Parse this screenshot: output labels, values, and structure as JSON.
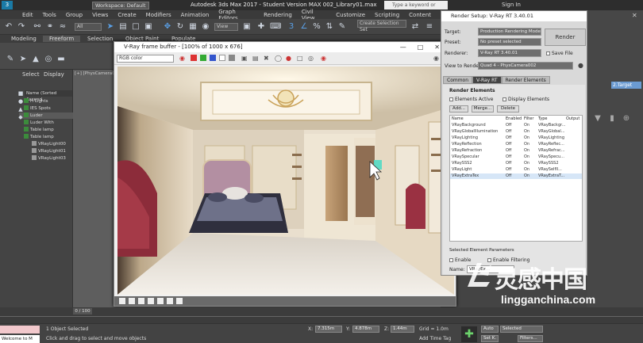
{
  "titlebar": {
    "workspace": "Workspace: Default",
    "title": "Autodesk 3ds Max 2017 - Student Version   MAX 002_Library01.max",
    "search_placeholder": "Type a keyword or phrase",
    "sign_in": "Sign In"
  },
  "menu": [
    "Edit",
    "Tools",
    "Group",
    "Views",
    "Create",
    "Modifiers",
    "Animation",
    "Graph Editors",
    "Rendering",
    "Civil View",
    "Customize",
    "Scripting",
    "Content"
  ],
  "toolbar": {
    "filter": "All",
    "view": "View",
    "selection_set": "Create Selection Set"
  },
  "ribbon_tabs": [
    "Modeling",
    "Freeform",
    "Selection",
    "Object Paint",
    "Populate"
  ],
  "scene": {
    "select_label": "Select",
    "display_label": "Display",
    "name_header": "Name (Sorted Ascend",
    "items": [
      "H Lights",
      "IES Spots",
      "Luder",
      "Luder With",
      "Table lamp",
      "Table lamp",
      "VRayLight00",
      "VRayLight01",
      "VRayLight03"
    ]
  },
  "viewport": {
    "label": "[+] [PhysCamera002",
    "frame": "0 / 100"
  },
  "vfb": {
    "title": "V-Ray frame buffer - [100% of 1000 x 676]",
    "channel": "RGB color"
  },
  "render_setup": {
    "title": "Render Setup: V-Ray RT 3.40.01",
    "target_label": "Target:",
    "target_value": "Production Rendering Mode",
    "preset_label": "Preset:",
    "preset_value": "No preset selected",
    "renderer_label": "Renderer:",
    "renderer_value": "V-Ray RT 3.40.01",
    "save_file": "Save File",
    "view_label": "View to Render:",
    "view_value": "Quad 4 - PhysCamera002",
    "render_button": "Render",
    "tabs": [
      "Common",
      "V-Ray RT",
      "Render Elements"
    ],
    "elements_header": "Render Elements",
    "elements_active": "Elements Active",
    "display_elements": "Display Elements",
    "add_btn": "Add...",
    "merge_btn": "Merge...",
    "delete_btn": "Delete",
    "columns": [
      "Name",
      "Enabled",
      "Filter",
      "Type",
      "Output"
    ],
    "rows": [
      [
        "VRayBackground",
        "Off",
        "On",
        "VRayBackgr..."
      ],
      [
        "VRayGlobalIllumination",
        "Off",
        "On",
        "VRayGlobal..."
      ],
      [
        "VRayLighting",
        "Off",
        "On",
        "VRayLighting"
      ],
      [
        "VRayReflection",
        "Off",
        "On",
        "VRayReflec..."
      ],
      [
        "VRayRefraction",
        "Off",
        "On",
        "VRayRefrac..."
      ],
      [
        "VRaySpecular",
        "Off",
        "On",
        "VRaySpecu..."
      ],
      [
        "VRaySSS2",
        "Off",
        "On",
        "VRaySSS2"
      ],
      [
        "VRayLight",
        "Off",
        "On",
        "VRaySelfIl..."
      ],
      [
        "VRayExtraTex",
        "Off",
        "On",
        "VRayExtraT..."
      ]
    ],
    "selected_params": "Selected Element Parameters",
    "enable_label": "Enable",
    "enable_filtering": "Enable Filtering",
    "name_label": "Name:",
    "name_value": "VRayEx..."
  },
  "rightpanel": {
    "label": "2.Target"
  },
  "status": {
    "maxscript": "Welcome to M",
    "selected": "1 Object Selected",
    "hint": "Click and drag to select and move objects",
    "x": "7.315m",
    "y": "4.878m",
    "z": "1.44m",
    "grid": "Grid = 1.0m",
    "add_time_tag": "Add Time Tag",
    "auto": "Auto",
    "selected_dd": "Selected",
    "set_k": "Set K.",
    "filters": "Filters..."
  },
  "watermark": {
    "cn": "灵感中国",
    "en": "lingganchina.com"
  },
  "colors": {
    "accent_blue": "#5aa0e6",
    "check_green": "#3c8b3c",
    "key_green": "#6cd36c"
  }
}
